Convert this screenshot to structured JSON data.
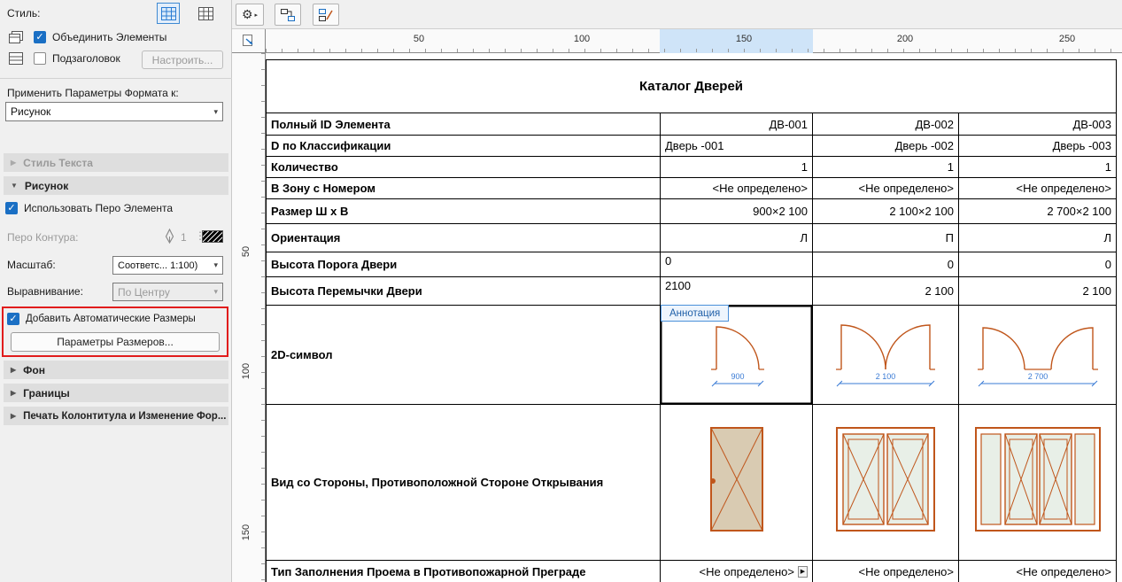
{
  "icons": {
    "gear": "⚙",
    "split_arrow": "▸",
    "dropdown_chevron": "▾",
    "collapsed_arrow": "▶",
    "expanded_arrow": "▼",
    "check": "✓",
    "popup_indicator": "▶",
    "dots_handle": "⋮"
  },
  "sidebar": {
    "style_label": "Стиль:",
    "merge_elements_label": "Объединить Элементы",
    "subtitle_label": "Подзаголовок",
    "configure_button": "Настроить...",
    "apply_format_label": "Применить Параметры Формата к:",
    "apply_format_value": "Рисунок",
    "section_text_style": "Стиль Текста",
    "section_drawing": "Рисунок",
    "section_background": "Фон",
    "section_borders": "Границы",
    "section_header_print": "Печать Колонтитула и Изменение Фор...",
    "use_element_pen_label": "Использовать Перо Элемента",
    "contour_pen_label": "Перо Контура:",
    "contour_pen_value": "1",
    "scale_label": "Масштаб:",
    "scale_value": "Соответс... 1:100)",
    "alignment_label": "Выравнивание:",
    "alignment_value": "По Центру",
    "auto_dimensions_label": "Добавить Автоматические Размеры",
    "dimension_params_button": "Параметры Размеров..."
  },
  "ruler": {
    "h": [
      "50",
      "100",
      "150",
      "200",
      "250"
    ],
    "v": [
      "50",
      "100",
      "150"
    ]
  },
  "table": {
    "title": "Каталог Дверей",
    "annotation": "Аннотация",
    "rows": [
      {
        "label": "Полный ID Элемента",
        "values": [
          "ДВ-001",
          "ДВ-002",
          "ДВ-003"
        ]
      },
      {
        "label": "D по Классификации",
        "values": [
          "Дверь -001",
          "Дверь -002",
          "Дверь -003"
        ]
      },
      {
        "label": "Количество",
        "values": [
          "1",
          "1",
          "1"
        ]
      },
      {
        "label": "В Зону с Номером",
        "values": [
          "<Не определено>",
          "<Не определено>",
          "<Не определено>"
        ]
      },
      {
        "label": "Размер Ш х В",
        "values": [
          "900×2 100",
          "2 100×2 100",
          "2 700×2 100"
        ]
      },
      {
        "label": "Ориентация",
        "values": [
          "Л",
          "П",
          "Л"
        ]
      },
      {
        "label": "Высота Порога Двери",
        "values": [
          "0",
          "0",
          "0"
        ]
      },
      {
        "label": "Высота Перемычки Двери",
        "values": [
          "2100",
          "2 100",
          "2 100"
        ]
      },
      {
        "label": "2D-символ",
        "dims": [
          "900",
          "2 100",
          "2 700"
        ]
      },
      {
        "label": "Вид со Стороны, Противоположной Стороне Открывания"
      },
      {
        "label": "Тип Заполнения Проема в Противопожарной Преграде",
        "values": [
          "<Не определено>",
          "<Не определено>",
          "<Не определено>"
        ]
      }
    ]
  }
}
